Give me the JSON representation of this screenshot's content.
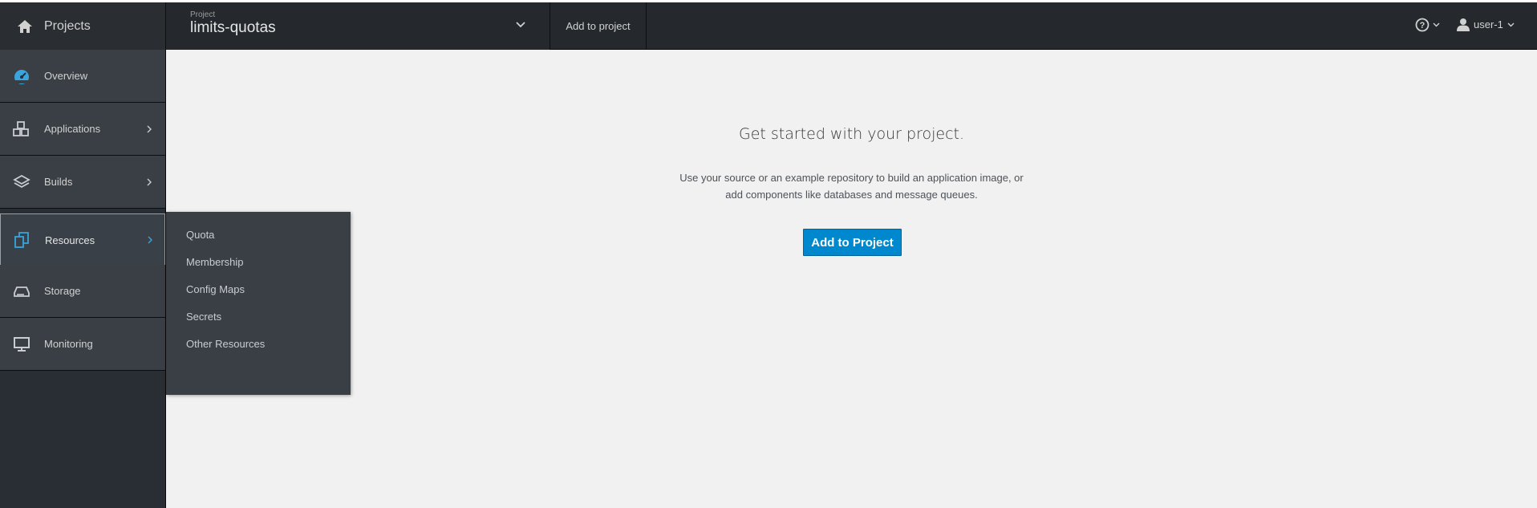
{
  "navbar": {
    "home_label": "Projects",
    "project_caption": "Project",
    "project_name": "limits-quotas",
    "add_to_project_link": "Add to project",
    "user_name": "user-1"
  },
  "sidebar": {
    "items": [
      {
        "label": "Overview",
        "icon": "dashboard-icon"
      },
      {
        "label": "Applications",
        "icon": "cubes-icon"
      },
      {
        "label": "Builds",
        "icon": "layers-icon"
      },
      {
        "label": "Resources",
        "icon": "files-icon",
        "active": true
      },
      {
        "label": "Storage",
        "icon": "hdd-icon"
      },
      {
        "label": "Monitoring",
        "icon": "monitor-icon"
      }
    ]
  },
  "resources_menu": {
    "items": [
      "Quota",
      "Membership",
      "Config Maps",
      "Secrets",
      "Other Resources"
    ]
  },
  "main": {
    "heading": "Get started with your project.",
    "description_line1": "Use your source or an example repository to build an application image, or",
    "description_line2": "add components like databases and message queues.",
    "cta_label": "Add to Project"
  },
  "colors": {
    "navbar_bg": "#25282d",
    "sidebar_bg": "#292e34",
    "nav_item_bg": "#393f45",
    "accent_blue": "#0088ce",
    "active_icon": "#39a5dc",
    "page_bg": "#f1f1f1"
  }
}
